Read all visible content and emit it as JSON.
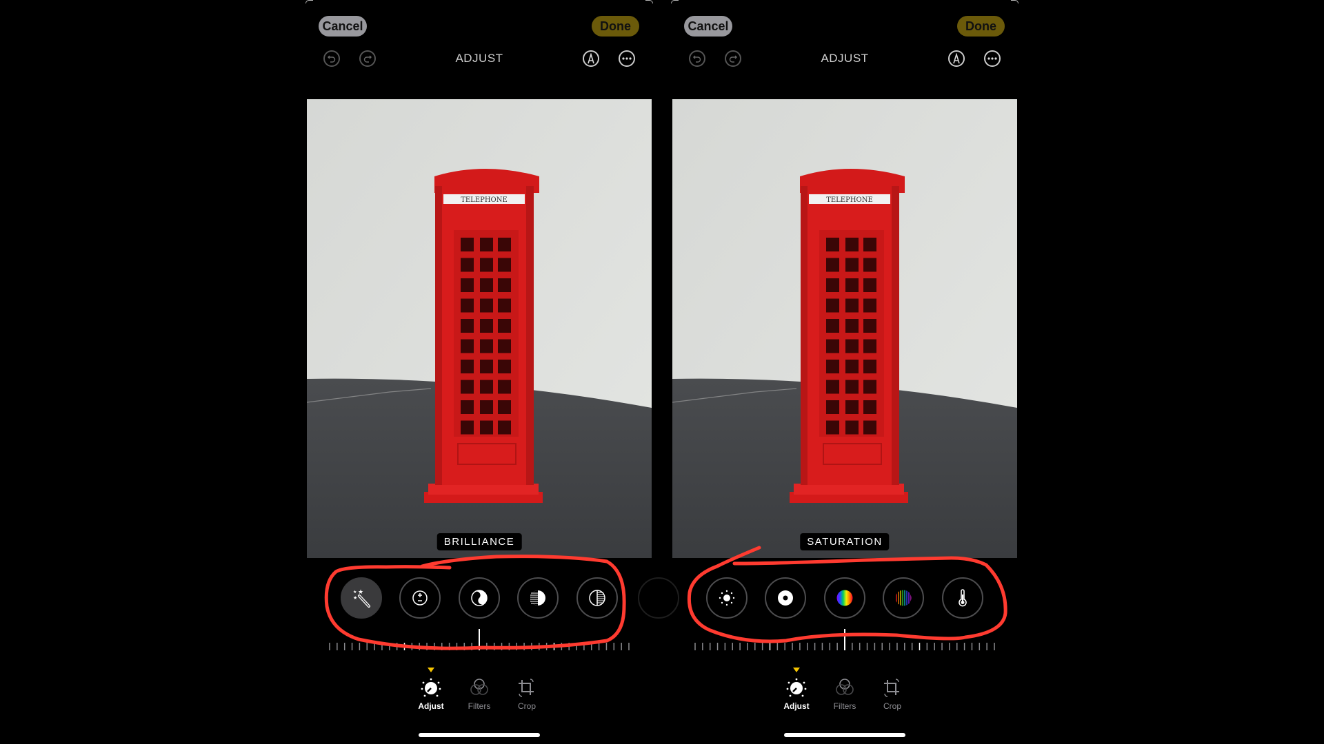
{
  "panels": [
    {
      "cancel_label": "Cancel",
      "done_label": "Done",
      "title": "ADJUST",
      "parameter_label": "BRILLIANCE",
      "tools": [
        {
          "name": "auto-enhance",
          "icon": "magic-wand-icon",
          "selected": true
        },
        {
          "name": "exposure",
          "icon": "exposure-icon",
          "selected": false
        },
        {
          "name": "brilliance",
          "icon": "yin-yang-icon",
          "selected": false
        },
        {
          "name": "highlights",
          "icon": "highlights-icon",
          "selected": false
        },
        {
          "name": "shadows",
          "icon": "shadows-icon",
          "selected": false
        }
      ],
      "tabs": [
        {
          "label": "Adjust",
          "icon": "adjust-dial-icon",
          "active": true
        },
        {
          "label": "Filters",
          "icon": "filters-icon",
          "active": false
        },
        {
          "label": "Crop",
          "icon": "crop-icon",
          "active": false
        }
      ],
      "slider_value": 0
    },
    {
      "cancel_label": "Cancel",
      "done_label": "Done",
      "title": "ADJUST",
      "parameter_label": "SATURATION",
      "tools": [
        {
          "name": "brightness",
          "icon": "sun-icon",
          "selected": false
        },
        {
          "name": "black-point",
          "icon": "black-point-icon",
          "selected": false
        },
        {
          "name": "saturation",
          "icon": "saturation-icon",
          "selected": false
        },
        {
          "name": "vibrance",
          "icon": "vibrance-icon",
          "selected": false
        },
        {
          "name": "warmth",
          "icon": "thermometer-icon",
          "selected": false
        }
      ],
      "tabs": [
        {
          "label": "Adjust",
          "icon": "adjust-dial-icon",
          "active": true
        },
        {
          "label": "Filters",
          "icon": "filters-icon",
          "active": false
        },
        {
          "label": "Crop",
          "icon": "crop-icon",
          "active": false
        }
      ],
      "slider_value": 0
    }
  ],
  "photo": {
    "sign_text": "TELEPHONE"
  },
  "colors": {
    "done_bg": "#6b5a0a",
    "cancel_bg": "#98989d",
    "accent_yellow": "#f5c400",
    "annotation_red": "#ff3b30",
    "booth_red": "#d81c1c"
  }
}
